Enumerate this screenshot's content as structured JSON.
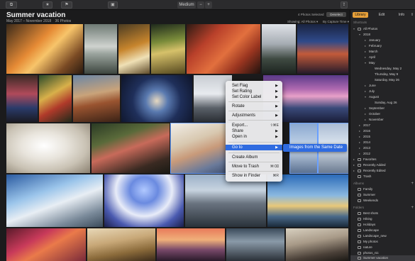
{
  "toolbar": {
    "view_label": "Medium",
    "zoom_out": "−",
    "zoom_in": "+"
  },
  "header": {
    "title": "Summer vacation",
    "date_range": "May 2017 – November 2018",
    "count": "36 Photos",
    "selection": "4 Photos Selected",
    "deselect": "Deselect",
    "showing": "Showing: All Photos ▾",
    "sort": "By Capture Time ▾"
  },
  "tabs": [
    "Library",
    "Edit",
    "Info"
  ],
  "context_menu": {
    "items": [
      {
        "label": "Set Flag",
        "submenu": true
      },
      {
        "label": "Set Rating",
        "submenu": true
      },
      {
        "label": "Set Color Label",
        "submenu": true
      },
      {
        "label": "Rotate",
        "submenu": true
      },
      {
        "label": "Adjustments",
        "submenu": true
      },
      {
        "label": "Export...",
        "shortcut": "⇧⌘E"
      },
      {
        "label": "Share",
        "submenu": true
      },
      {
        "label": "Open in",
        "submenu": true
      },
      {
        "label": "Go to",
        "submenu": true,
        "highlighted": true
      },
      {
        "label": "Create Album"
      },
      {
        "label": "Move to Trash",
        "shortcut": "⌘⌫"
      },
      {
        "label": "Show in Finder",
        "shortcut": "⌘R"
      }
    ],
    "submenu_item": "Images from the Same Date"
  },
  "sidebar": {
    "shortcuts_header": "Shortcuts",
    "all_photos": "All Photos",
    "years": [
      "2018",
      "2017",
      "2016",
      "2015",
      "2014",
      "2013",
      "2012"
    ],
    "months_2018": [
      "January",
      "February",
      "March",
      "April",
      "May"
    ],
    "may_days": [
      "Wednesday, May 2",
      "Thursday, May 9",
      "Saturday, May 26"
    ],
    "months_2018_b": [
      "June",
      "July",
      "August"
    ],
    "aug_days": [
      "Sunday, Aug 26"
    ],
    "months_2018_c": [
      "September",
      "October",
      "November"
    ],
    "favorites": "Favorites",
    "recently_added": "Recently Added",
    "recently_edited": "Recently Edited",
    "trash": "Trash",
    "albums_header": "Albums",
    "albums": [
      "Family",
      "Summer",
      "Weekends"
    ],
    "folders_header": "Folders",
    "folders": [
      "Best shots",
      "Hiking",
      "Holidays",
      "Landscape",
      "Landscape_new",
      "My photos",
      "nature",
      "photos_nic",
      "Summer vacation"
    ]
  },
  "colors": {
    "accent": "#e8a13a",
    "highlight": "#2f6be0",
    "bg": "#1b1b1c"
  }
}
